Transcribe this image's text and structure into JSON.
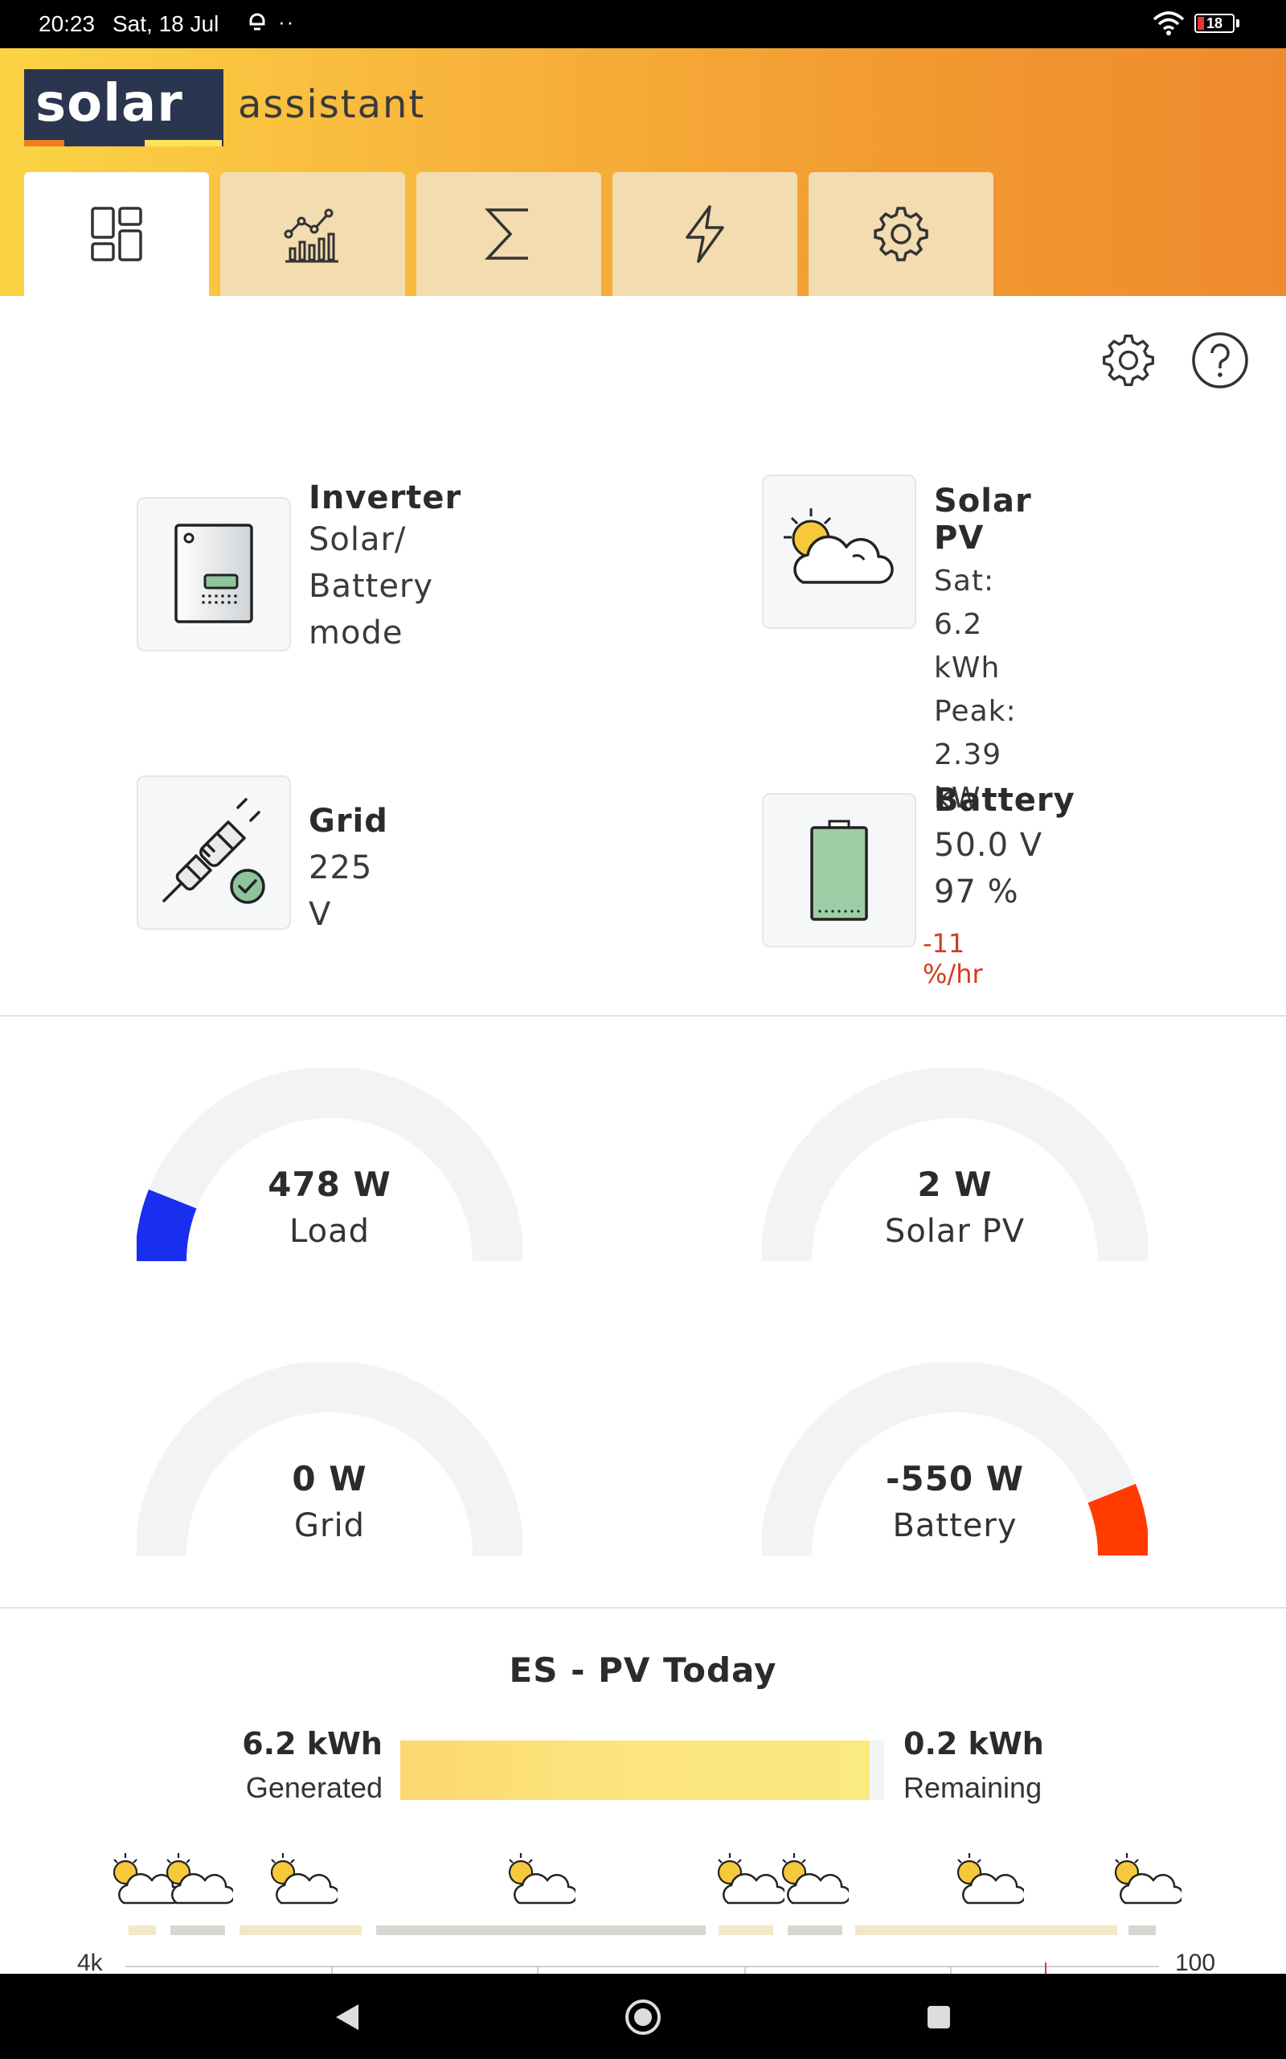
{
  "status_bar": {
    "time": "20:23",
    "date": "Sat, 18 Jul",
    "battery": "18"
  },
  "header": {
    "logo_word": "solar",
    "logo_sub": "assistant"
  },
  "tabs": [
    {
      "icon": "dashboard-icon",
      "active": true
    },
    {
      "icon": "chart-icon",
      "active": false
    },
    {
      "icon": "sum-icon",
      "active": false
    },
    {
      "icon": "lightning-icon",
      "active": false
    },
    {
      "icon": "gear-icon",
      "active": false
    }
  ],
  "cards": {
    "inverter": {
      "title": "Inverter",
      "lines": [
        "Solar/",
        "Battery",
        "mode"
      ]
    },
    "solar": {
      "title": "Solar PV",
      "line1": "Sat: 6.2 kWh",
      "line2": "Peak: 2.39 kW"
    },
    "grid": {
      "title": "Grid",
      "line1": "225 V"
    },
    "battery": {
      "title": "Battery",
      "line1": "50.0 V",
      "line2": "97 %",
      "rate": "-11 %/hr"
    }
  },
  "gauges": [
    {
      "value": "478 W",
      "label": "Load",
      "color": "#1a2ef0",
      "fraction": 0.12,
      "side": "left"
    },
    {
      "value": "2 W",
      "label": "Solar PV",
      "color": "#1a2ef0",
      "fraction": 0.0,
      "side": "left"
    },
    {
      "value": "0 W",
      "label": "Grid",
      "color": "#1a2ef0",
      "fraction": 0.0,
      "side": "left"
    },
    {
      "value": "-550 W",
      "label": "Battery",
      "color": "#ff3b00",
      "fraction": 0.12,
      "side": "right"
    }
  ],
  "pv_today": {
    "title": "ES - PV Today",
    "generated_value": "6.2 kWh",
    "generated_label": "Generated",
    "remaining_value": "0.2 kWh",
    "remaining_label": "Remaining",
    "fill_fraction": 0.97,
    "axis_left": "4k",
    "axis_right": "100"
  }
}
